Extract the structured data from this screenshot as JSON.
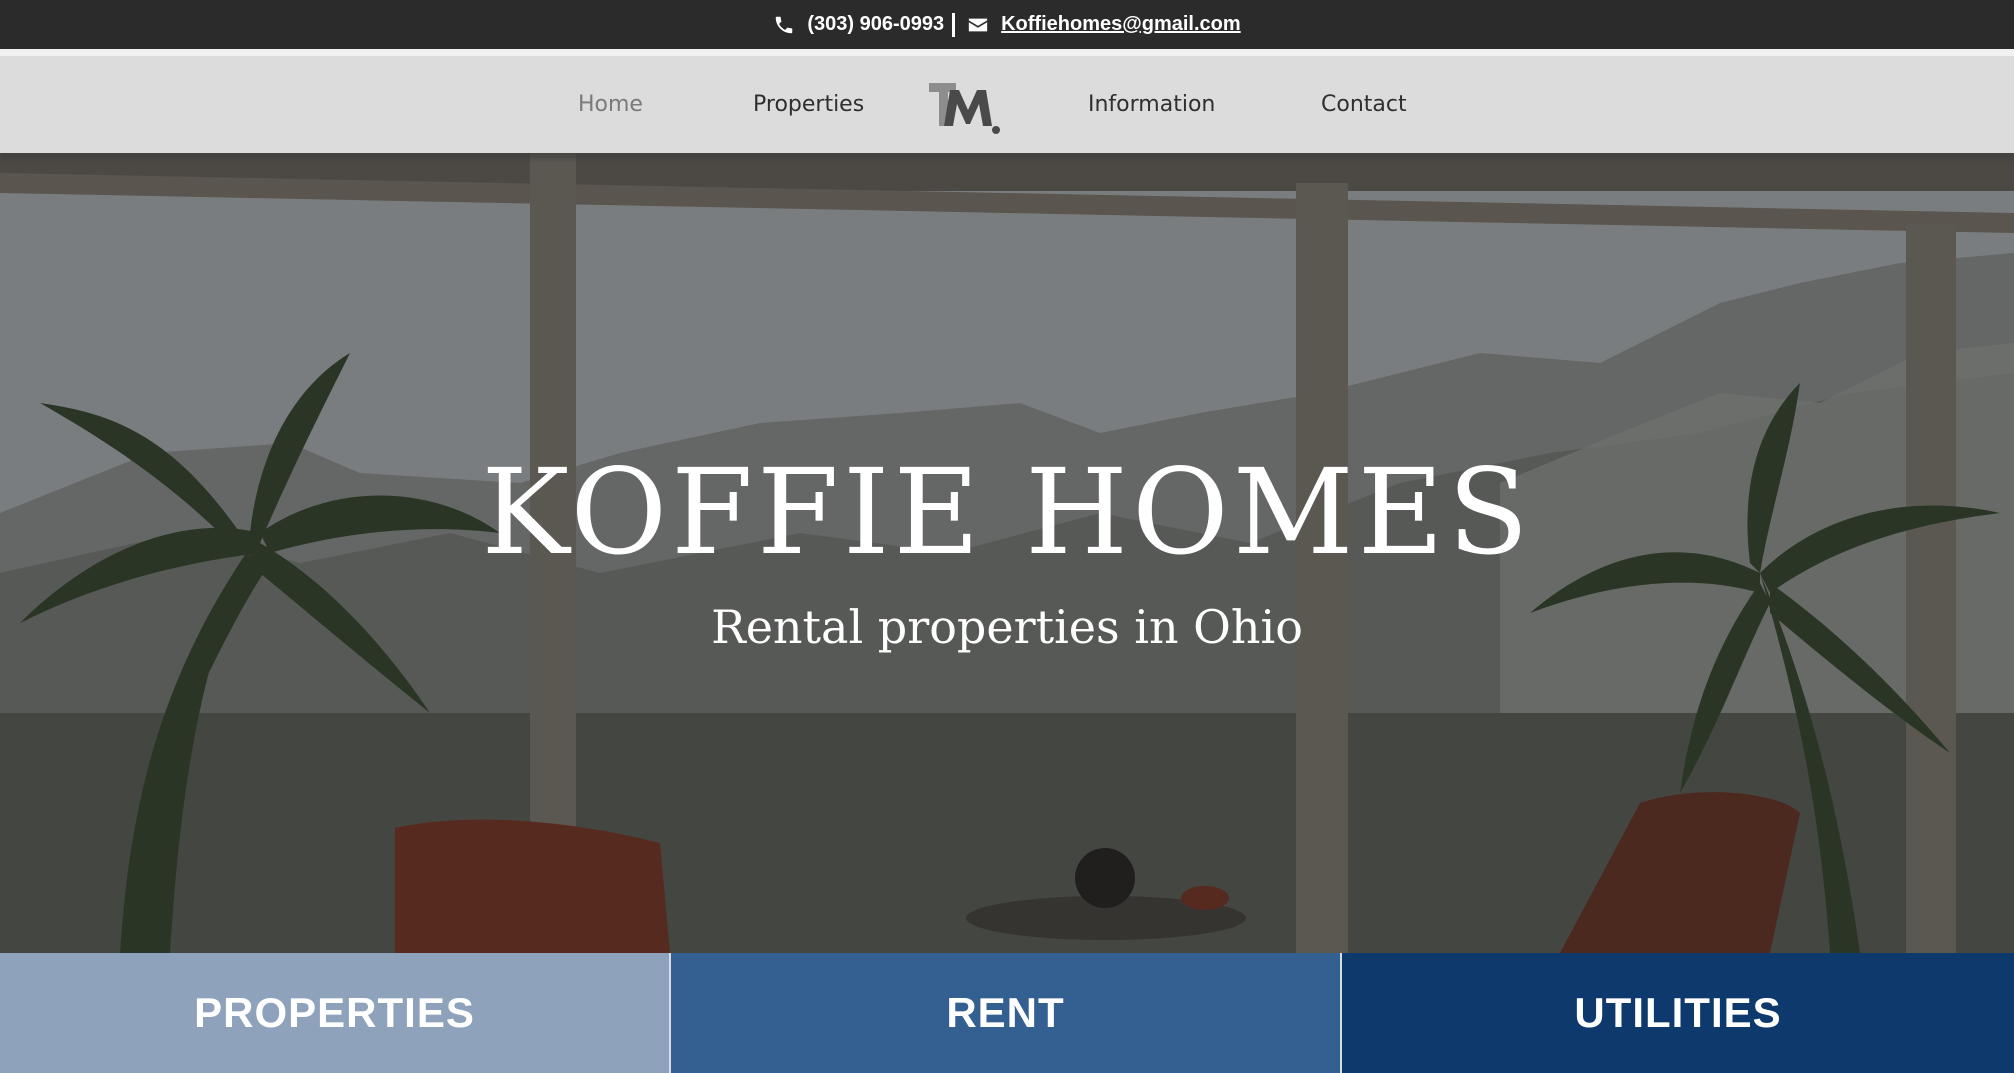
{
  "topbar": {
    "phone": "(303) 906-0993",
    "email": "Koffiehomes@gmail.com",
    "phone_icon": "phone-icon",
    "email_icon": "envelope-icon"
  },
  "nav": {
    "items": [
      {
        "label": "Home",
        "active": true
      },
      {
        "label": "Properties",
        "active": false
      },
      {
        "label": "Information",
        "active": false
      },
      {
        "label": "Contact",
        "active": false
      }
    ],
    "logo_text": "TM"
  },
  "hero": {
    "title": "KOFFIE HOMES",
    "subtitle": "Rental properties in Ohio"
  },
  "tiles": [
    {
      "label": "PROPERTIES",
      "color": "#8ea3bb"
    },
    {
      "label": "RENT",
      "color": "#335f91"
    },
    {
      "label": "UTILITIES",
      "color": "#0d396d"
    }
  ],
  "colors": {
    "topbar_bg": "#2b2b2b",
    "nav_bg": "#dcdcdc",
    "nav_active": "#7a7a7a"
  }
}
